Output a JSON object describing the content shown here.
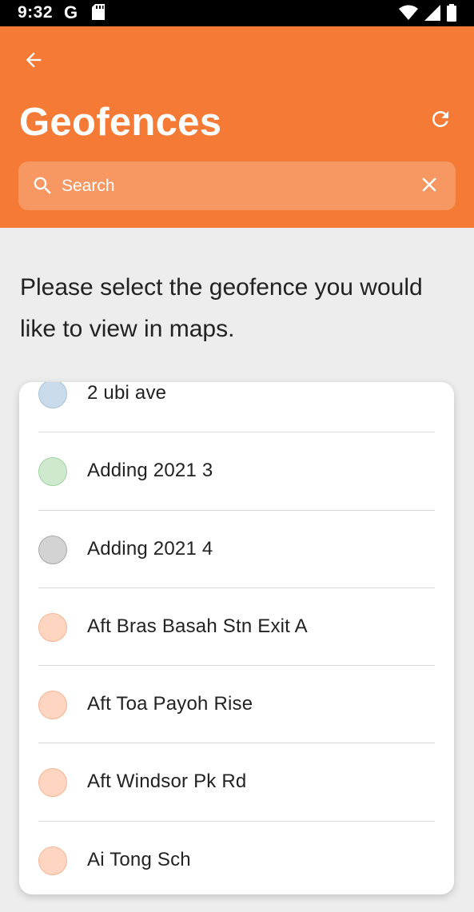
{
  "status_bar": {
    "time": "9:32",
    "g_letter": "G",
    "icons": [
      "sd-card-icon",
      "wifi-icon",
      "signal-icon",
      "battery-icon"
    ]
  },
  "header": {
    "title": "Geofences",
    "background_color": "#f57a35",
    "back_icon": "arrow-left-icon",
    "refresh_icon": "refresh-icon"
  },
  "search": {
    "placeholder": "Search",
    "value": "",
    "clear_icon": "close-icon"
  },
  "prompt": "Please select the geofence you would like to view in maps.",
  "geofences": [
    {
      "name": "2 ubi ave",
      "dot_color": "#c9dbea",
      "dot_border": "#a9c4da"
    },
    {
      "name": "Adding 2021 3",
      "dot_color": "#cfe9cf",
      "dot_border": "#9ed49e"
    },
    {
      "name": "Adding 2021 4",
      "dot_color": "#d3d3d3",
      "dot_border": "#a9a9a9"
    },
    {
      "name": "Aft Bras Basah Stn Exit A",
      "dot_color": "#fdd5c1",
      "dot_border": "#f7b594"
    },
    {
      "name": "Aft Toa Payoh Rise",
      "dot_color": "#fdd5c1",
      "dot_border": "#f7b594"
    },
    {
      "name": "Aft Windsor Pk Rd",
      "dot_color": "#fdd5c1",
      "dot_border": "#f7b594"
    },
    {
      "name": "Ai Tong Sch",
      "dot_color": "#fdd5c1",
      "dot_border": "#f7b594"
    }
  ]
}
